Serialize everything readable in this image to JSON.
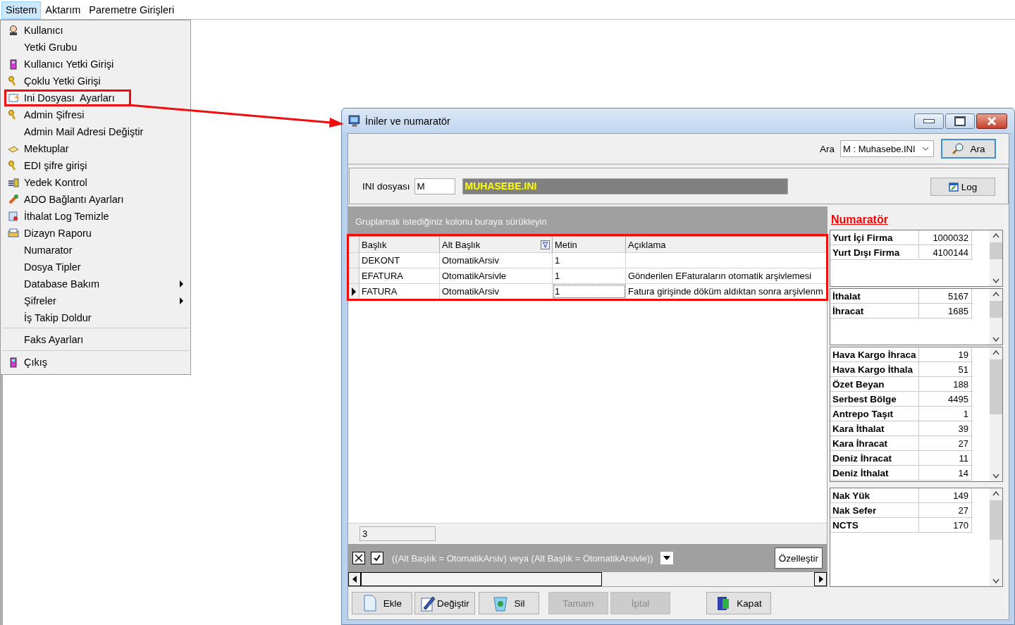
{
  "menubar": [
    {
      "label": "Sistem",
      "selected": true
    },
    {
      "label": "Aktarım",
      "selected": false
    },
    {
      "label": "Paremetre Girişleri",
      "selected": false
    }
  ],
  "menu": {
    "items": [
      {
        "label": "Kullanıcı",
        "has_icon": true,
        "submenu": false,
        "separator_before": false,
        "highlighted": false
      },
      {
        "label": "Yetki Grubu",
        "has_icon": false,
        "submenu": false,
        "separator_before": false,
        "highlighted": false
      },
      {
        "label": "Kullanıcı Yetki Girişi",
        "has_icon": true,
        "submenu": false,
        "separator_before": false,
        "highlighted": false
      },
      {
        "label": "Çoklu Yetki Girişi",
        "has_icon": true,
        "submenu": false,
        "separator_before": false,
        "highlighted": false
      },
      {
        "label": "Ini Dosyası  Ayarları",
        "has_icon": true,
        "submenu": false,
        "separator_before": false,
        "highlighted": true
      },
      {
        "label": "Admin Şifresi",
        "has_icon": true,
        "submenu": false,
        "separator_before": false,
        "highlighted": false
      },
      {
        "label": "Admin Mail Adresi Değiştir",
        "has_icon": false,
        "submenu": false,
        "separator_before": false,
        "highlighted": false
      },
      {
        "label": "Mektuplar",
        "has_icon": true,
        "submenu": false,
        "separator_before": false,
        "highlighted": false
      },
      {
        "label": "EDI şifre girişi",
        "has_icon": true,
        "submenu": false,
        "separator_before": false,
        "highlighted": false
      },
      {
        "label": "Yedek Kontrol",
        "has_icon": true,
        "submenu": false,
        "separator_before": false,
        "highlighted": false
      },
      {
        "label": "ADO Bağlantı Ayarları",
        "has_icon": true,
        "submenu": false,
        "separator_before": false,
        "highlighted": false
      },
      {
        "label": "İthalat Log Temizle",
        "has_icon": true,
        "submenu": false,
        "separator_before": false,
        "highlighted": false
      },
      {
        "label": "Dizayn Raporu",
        "has_icon": true,
        "submenu": false,
        "separator_before": false,
        "highlighted": false
      },
      {
        "label": "Numarator",
        "has_icon": false,
        "submenu": false,
        "separator_before": false,
        "highlighted": false
      },
      {
        "label": "Dosya Tipler",
        "has_icon": false,
        "submenu": false,
        "separator_before": false,
        "highlighted": false
      },
      {
        "label": "Database Bakım",
        "has_icon": false,
        "submenu": true,
        "separator_before": false,
        "highlighted": false
      },
      {
        "label": "Şifreler",
        "has_icon": false,
        "submenu": true,
        "separator_before": false,
        "highlighted": false
      },
      {
        "label": "İş Takip Doldur",
        "has_icon": false,
        "submenu": false,
        "separator_before": false,
        "highlighted": false
      },
      {
        "label": "Faks Ayarları",
        "has_icon": false,
        "submenu": false,
        "separator_before": true,
        "highlighted": false
      },
      {
        "label": "Çıkış",
        "has_icon": true,
        "submenu": false,
        "separator_before": true,
        "highlighted": false
      }
    ]
  },
  "annotation_arrow": true,
  "dialog": {
    "title": "İniler ve numaratör",
    "search": {
      "label": "Ara",
      "value": "M : Muhasebe.INI",
      "button": "Ara"
    },
    "ini": {
      "label": "INI dosyası",
      "code": "M",
      "name": "MUHASEBE.INI",
      "log_button": "Log"
    },
    "grid": {
      "group_hint": "Gruplamak istediğiniz kolonu buraya sürükleyin",
      "highlighted": true,
      "columns": [
        {
          "label": "Başlık",
          "filter": false
        },
        {
          "label": "Alt Başlık",
          "filter": true
        },
        {
          "label": "Metin",
          "filter": false
        },
        {
          "label": "Açıklama",
          "filter": false
        }
      ],
      "rows": [
        {
          "selected": false,
          "cells": [
            {
              "text": "DEKONT",
              "focused": false
            },
            {
              "text": "OtomatikArsiv",
              "focused": false
            },
            {
              "text": "1",
              "focused": false
            }
          ]
        },
        {
          "selected": false,
          "cells": [
            {
              "text": "EFATURA",
              "focused": false
            },
            {
              "text": "OtomatikArsivle",
              "focused": false
            },
            {
              "text": "1",
              "focused": false
            },
            {
              "text": "Gönderilen EFaturaların otomatik arşivlemesi",
              "focused": false
            }
          ]
        },
        {
          "selected": true,
          "cells": [
            {
              "text": "FATURA",
              "focused": false
            },
            {
              "text": "OtomatikArsiv",
              "focused": false
            },
            {
              "text": "1",
              "focused": true
            },
            {
              "text": "Fatura girişinde döküm aldıktan sonra arşivlenm",
              "focused": false
            }
          ]
        }
      ],
      "footer_count": "3",
      "filter": {
        "checked": true,
        "text": "((Alt Başlık = OtomatikArsiv) veya (Alt Başlık = OtomatikArsivle))",
        "button": "Özelleştir"
      }
    },
    "numerator": {
      "title": "Numaratör",
      "lists": [
        {
          "rows": [
            {
              "name": "Yurt İçi Firma",
              "value": "1000032"
            },
            {
              "name": "Yurt Dışı Firma",
              "value": "4100144"
            }
          ]
        },
        {
          "rows": [
            {
              "name": "İthalat",
              "value": "5167"
            },
            {
              "name": "İhracat",
              "value": "1685"
            }
          ]
        },
        {
          "rows": [
            {
              "name": "Hava Kargo İhraca",
              "value": "19"
            },
            {
              "name": "Hava Kargo İthala",
              "value": "51"
            },
            {
              "name": "Özet Beyan",
              "value": "188"
            },
            {
              "name": "Serbest Bölge",
              "value": "4495"
            },
            {
              "name": "Antrepo Taşıt",
              "value": "1"
            },
            {
              "name": "Kara İthalat",
              "value": "39"
            },
            {
              "name": "Kara İhracat",
              "value": "27"
            },
            {
              "name": "Deniz İhracat",
              "value": "11"
            },
            {
              "name": "Deniz İthalat",
              "value": "14"
            }
          ]
        },
        {
          "rows": [
            {
              "name": "Nak Yük",
              "value": "149"
            },
            {
              "name": "Nak Sefer",
              "value": "27"
            },
            {
              "name": "NCTS",
              "value": "170"
            }
          ]
        }
      ]
    },
    "buttons": [
      {
        "label": "Ekle",
        "disabled": false,
        "has_icon": true
      },
      {
        "label": "Değiştir",
        "disabled": false,
        "has_icon": true
      },
      {
        "label": "Sil",
        "disabled": false,
        "has_icon": true
      },
      {
        "label": "Tamam",
        "disabled": true,
        "has_icon": false
      },
      {
        "label": "İptal",
        "disabled": true,
        "has_icon": false
      },
      {
        "label": "Kapat",
        "disabled": false,
        "has_icon": true
      }
    ]
  }
}
